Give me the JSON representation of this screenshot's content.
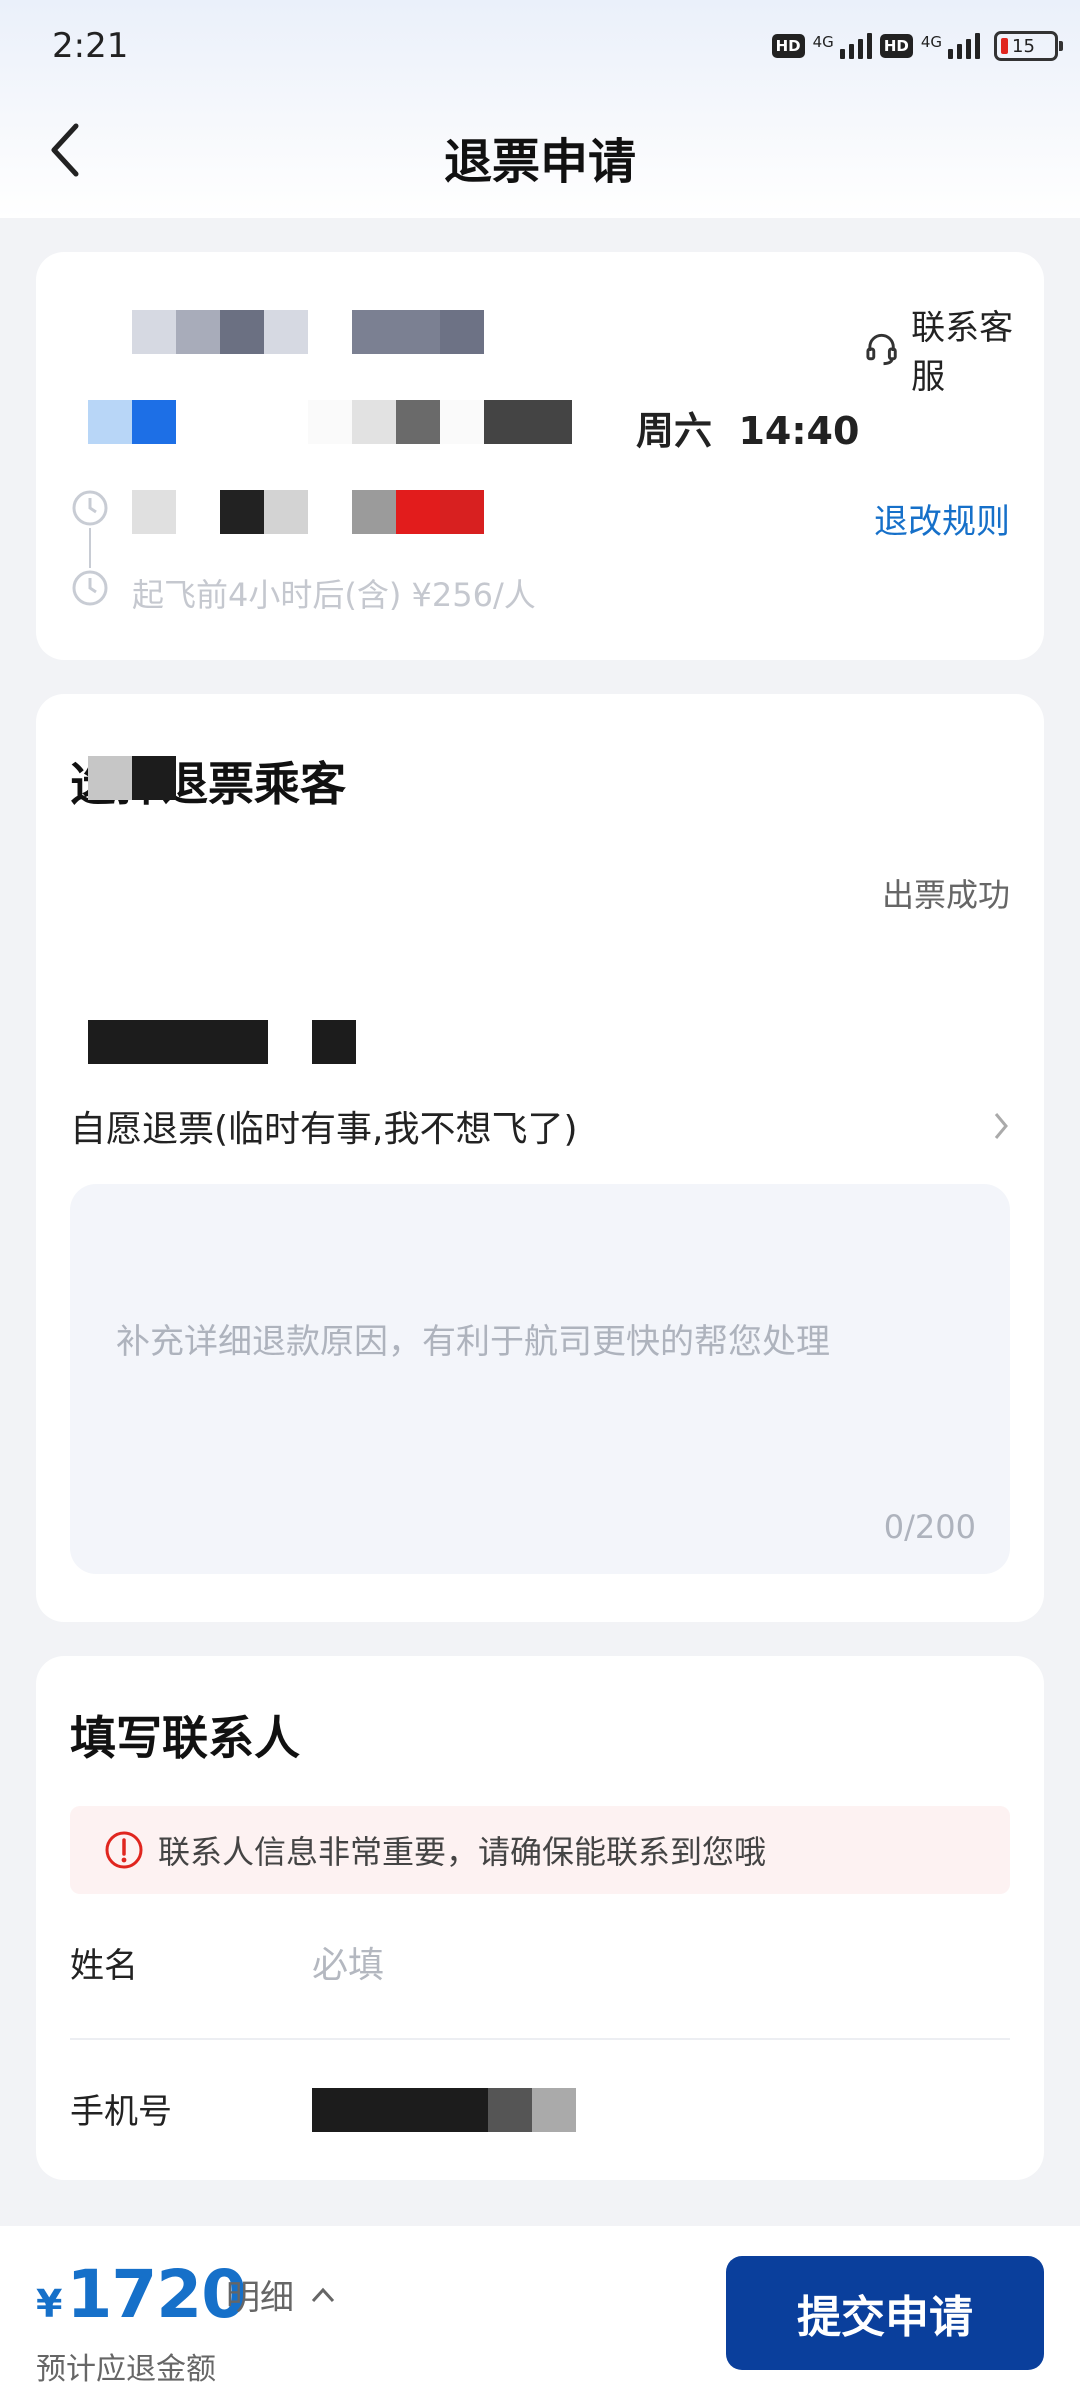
{
  "status_bar": {
    "time": "2:21",
    "hd1": "HD",
    "net1": "4G",
    "hd2": "HD",
    "net2": "4G",
    "battery": "15"
  },
  "header": {
    "title": "退票申请"
  },
  "flight_card": {
    "contact_service": "联系客服",
    "flight_time": "周六  14:40",
    "refund_rules": "退改规则",
    "fee_note": "起飞前4小时后(含) ¥256/人"
  },
  "passenger_card": {
    "title": "选择退票乘客",
    "ticket_status": "出票成功",
    "reason": "自愿退票(临时有事,我不想飞了)",
    "reason_placeholder": "补充详细退款原因，有利于航司更快的帮您处理",
    "char_counter": "0/200"
  },
  "contact_card": {
    "title": "填写联系人",
    "notice": "联系人信息非常重要，请确保能联系到您哦",
    "name_label": "姓名",
    "name_placeholder": "必填",
    "phone_label": "手机号"
  },
  "footer": {
    "currency": "¥",
    "amount": "1720",
    "detail": "明细",
    "estimate_label": "预计应退金额",
    "submit": "提交申请"
  },
  "colors": {
    "accent": "#1670c9",
    "primary_button": "#0a3f9c",
    "notice_bg": "#fdf2f2",
    "warning_red": "#e0261f"
  }
}
